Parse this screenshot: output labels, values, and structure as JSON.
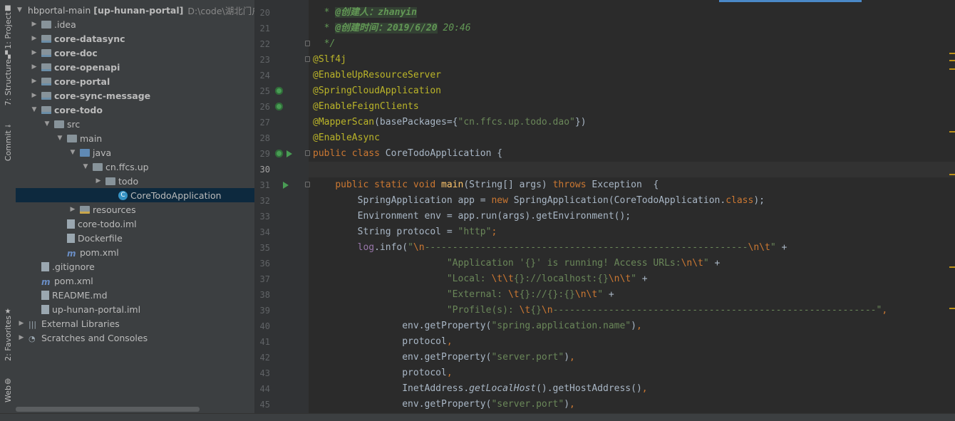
{
  "left_tool_tabs": [
    {
      "label": "1: Project",
      "icon": "folder-icon"
    },
    {
      "label": "7: Structure",
      "icon": "structure-icon"
    },
    {
      "label": "Commit",
      "icon": "commit-icon"
    },
    {
      "label": "2: Favorites",
      "icon": "star-icon"
    },
    {
      "label": "Web",
      "icon": "globe-icon"
    }
  ],
  "project_tree": {
    "root": {
      "name": "hbportal-main",
      "module": "[up-hunan-portal]",
      "path": "D:\\code\\湖北门户"
    },
    "items": [
      {
        "label": ".idea",
        "arrow": "▶",
        "icon": "folder"
      },
      {
        "label": "core-datasync",
        "arrow": "▶",
        "icon": "module"
      },
      {
        "label": "core-doc",
        "arrow": "▶",
        "icon": "module"
      },
      {
        "label": "core-openapi",
        "arrow": "▶",
        "icon": "module"
      },
      {
        "label": "core-portal",
        "arrow": "▶",
        "icon": "module"
      },
      {
        "label": "core-sync-message",
        "arrow": "▶",
        "icon": "module"
      },
      {
        "label": "core-todo",
        "arrow": "▼",
        "icon": "module"
      },
      {
        "label": "src",
        "arrow": "▼",
        "icon": "folder"
      },
      {
        "label": "main",
        "arrow": "▼",
        "icon": "folder"
      },
      {
        "label": "java",
        "arrow": "▼",
        "icon": "source-folder"
      },
      {
        "label": "cn.ffcs.up",
        "arrow": "▼",
        "icon": "package"
      },
      {
        "label": "todo",
        "arrow": "▶",
        "icon": "package"
      },
      {
        "label": "CoreTodoApplication",
        "arrow": "",
        "icon": "class",
        "selected": true
      },
      {
        "label": "resources",
        "arrow": "▶",
        "icon": "resources-folder"
      },
      {
        "label": "core-todo.iml",
        "arrow": "",
        "icon": "file"
      },
      {
        "label": "Dockerfile",
        "arrow": "",
        "icon": "file"
      },
      {
        "label": "pom.xml",
        "arrow": "",
        "icon": "maven"
      },
      {
        "label": ".gitignore",
        "arrow": "",
        "icon": "file"
      },
      {
        "label": "pom.xml",
        "arrow": "",
        "icon": "maven"
      },
      {
        "label": "README.md",
        "arrow": "",
        "icon": "file"
      },
      {
        "label": "up-hunan-portal.iml",
        "arrow": "",
        "icon": "file"
      },
      {
        "label": "External Libraries",
        "arrow": "▶",
        "icon": "library"
      },
      {
        "label": "Scratches and Consoles",
        "arrow": "▶",
        "icon": "scratches"
      }
    ]
  },
  "editor": {
    "current_line": 30,
    "lines": [
      {
        "n": 20,
        "tokens": [
          [
            "doc",
            "  * "
          ],
          [
            "doctag",
            "@创建人：zhanyin"
          ]
        ]
      },
      {
        "n": 21,
        "tokens": [
          [
            "doc",
            "  * "
          ],
          [
            "doctag",
            "@创建时间：2019/6/20"
          ],
          [
            "doc",
            " 20:46"
          ]
        ]
      },
      {
        "n": 22,
        "tokens": [
          [
            "doc",
            "  */"
          ]
        ]
      },
      {
        "n": 23,
        "tokens": [
          [
            "ann",
            "@Slf4j"
          ]
        ]
      },
      {
        "n": 24,
        "tokens": [
          [
            "ann",
            "@EnableUpResourceServer"
          ]
        ]
      },
      {
        "n": 25,
        "tokens": [
          [
            "ann",
            "@SpringCloudApplication"
          ]
        ]
      },
      {
        "n": 26,
        "tokens": [
          [
            "ann",
            "@EnableFeignClients"
          ]
        ]
      },
      {
        "n": 27,
        "tokens": [
          [
            "ann",
            "@MapperScan"
          ],
          [
            "plain",
            "(basePackages="
          ],
          [
            "plain",
            "{"
          ],
          [
            "str",
            "\"cn.ffcs.up.todo.dao\""
          ],
          [
            "plain",
            "})"
          ]
        ]
      },
      {
        "n": 28,
        "tokens": [
          [
            "ann",
            "@EnableAsync"
          ]
        ]
      },
      {
        "n": 29,
        "tokens": [
          [
            "kw",
            "public class "
          ],
          [
            "plain",
            "CoreTodoApplication {"
          ]
        ]
      },
      {
        "n": 30,
        "tokens": []
      },
      {
        "n": 31,
        "tokens": [
          [
            "plain",
            "    "
          ],
          [
            "kw",
            "public static void "
          ],
          [
            "fn",
            "main"
          ],
          [
            "plain",
            "(String[] args) "
          ],
          [
            "kw",
            "throws "
          ],
          [
            "plain",
            "Exception  {"
          ]
        ]
      },
      {
        "n": 32,
        "tokens": [
          [
            "plain",
            "        SpringApplication app = "
          ],
          [
            "kw",
            "new "
          ],
          [
            "plain",
            "SpringApplication(CoreTodoApplication."
          ],
          [
            "kw",
            "class"
          ],
          [
            "plain",
            ");"
          ]
        ]
      },
      {
        "n": 33,
        "tokens": [
          [
            "plain",
            "        Environment env = app.run(args).getEnvironment();"
          ]
        ]
      },
      {
        "n": 34,
        "tokens": [
          [
            "plain",
            "        String protocol = "
          ],
          [
            "str",
            "\"http\""
          ],
          [
            "kw",
            ";"
          ]
        ]
      },
      {
        "n": 35,
        "tokens": [
          [
            "plain",
            "        "
          ],
          [
            "field",
            "log"
          ],
          [
            "plain",
            ".info("
          ],
          [
            "str",
            "\""
          ],
          [
            "esc",
            "\\n"
          ],
          [
            "str",
            "----------------------------------------------------------"
          ],
          [
            "esc",
            "\\n\\t"
          ],
          [
            "str",
            "\""
          ],
          [
            "plain",
            " +"
          ]
        ]
      },
      {
        "n": 36,
        "tokens": [
          [
            "plain",
            "                        "
          ],
          [
            "str",
            "\"Application '{}' is running! Access URLs:"
          ],
          [
            "esc",
            "\\n\\t"
          ],
          [
            "str",
            "\""
          ],
          [
            "plain",
            " +"
          ]
        ]
      },
      {
        "n": 37,
        "tokens": [
          [
            "plain",
            "                        "
          ],
          [
            "str",
            "\"Local: "
          ],
          [
            "esc",
            "\\t\\t"
          ],
          [
            "str",
            "{}://localhost:{}"
          ],
          [
            "esc",
            "\\n\\t"
          ],
          [
            "str",
            "\""
          ],
          [
            "plain",
            " +"
          ]
        ]
      },
      {
        "n": 38,
        "tokens": [
          [
            "plain",
            "                        "
          ],
          [
            "str",
            "\"External: "
          ],
          [
            "esc",
            "\\t"
          ],
          [
            "str",
            "{}://{}:{}"
          ],
          [
            "esc",
            "\\n\\t"
          ],
          [
            "str",
            "\""
          ],
          [
            "plain",
            " +"
          ]
        ]
      },
      {
        "n": 39,
        "tokens": [
          [
            "plain",
            "                        "
          ],
          [
            "str",
            "\"Profile(s): "
          ],
          [
            "esc",
            "\\t"
          ],
          [
            "str",
            "{}"
          ],
          [
            "esc",
            "\\n"
          ],
          [
            "str",
            "----------------------------------------------------------\""
          ],
          [
            "kw",
            ","
          ]
        ]
      },
      {
        "n": 40,
        "tokens": [
          [
            "plain",
            "                env.getProperty("
          ],
          [
            "str",
            "\"spring.application.name\""
          ],
          [
            "plain",
            ")"
          ],
          [
            "kw",
            ","
          ]
        ]
      },
      {
        "n": 41,
        "tokens": [
          [
            "plain",
            "                protocol"
          ],
          [
            "kw",
            ","
          ]
        ]
      },
      {
        "n": 42,
        "tokens": [
          [
            "plain",
            "                env.getProperty("
          ],
          [
            "str",
            "\"server.port\""
          ],
          [
            "plain",
            ")"
          ],
          [
            "kw",
            ","
          ]
        ]
      },
      {
        "n": 43,
        "tokens": [
          [
            "plain",
            "                protocol"
          ],
          [
            "kw",
            ","
          ]
        ]
      },
      {
        "n": 44,
        "tokens": [
          [
            "plain",
            "                InetAddress."
          ],
          [
            "static",
            "getLocalHost"
          ],
          [
            "plain",
            "().getHostAddress()"
          ],
          [
            "kw",
            ","
          ]
        ]
      },
      {
        "n": 45,
        "tokens": [
          [
            "plain",
            "                env.getProperty("
          ],
          [
            "str",
            "\"server.port\""
          ],
          [
            "plain",
            ")"
          ],
          [
            "kw",
            ","
          ]
        ]
      }
    ],
    "gutter_icons": {
      "25": [
        "bean"
      ],
      "26": [
        "bean"
      ],
      "29": [
        "bean",
        "run"
      ],
      "31": [
        "run"
      ]
    },
    "fold_lines": [
      22,
      23,
      29,
      31
    ]
  },
  "colors": {
    "editor_bg": "#2b2b2b",
    "panel_bg": "#3c3f41",
    "keyword": "#cc7832",
    "annotation": "#bbb529",
    "string": "#6a8759",
    "method": "#ffc66d",
    "selection": "#0d293e"
  }
}
